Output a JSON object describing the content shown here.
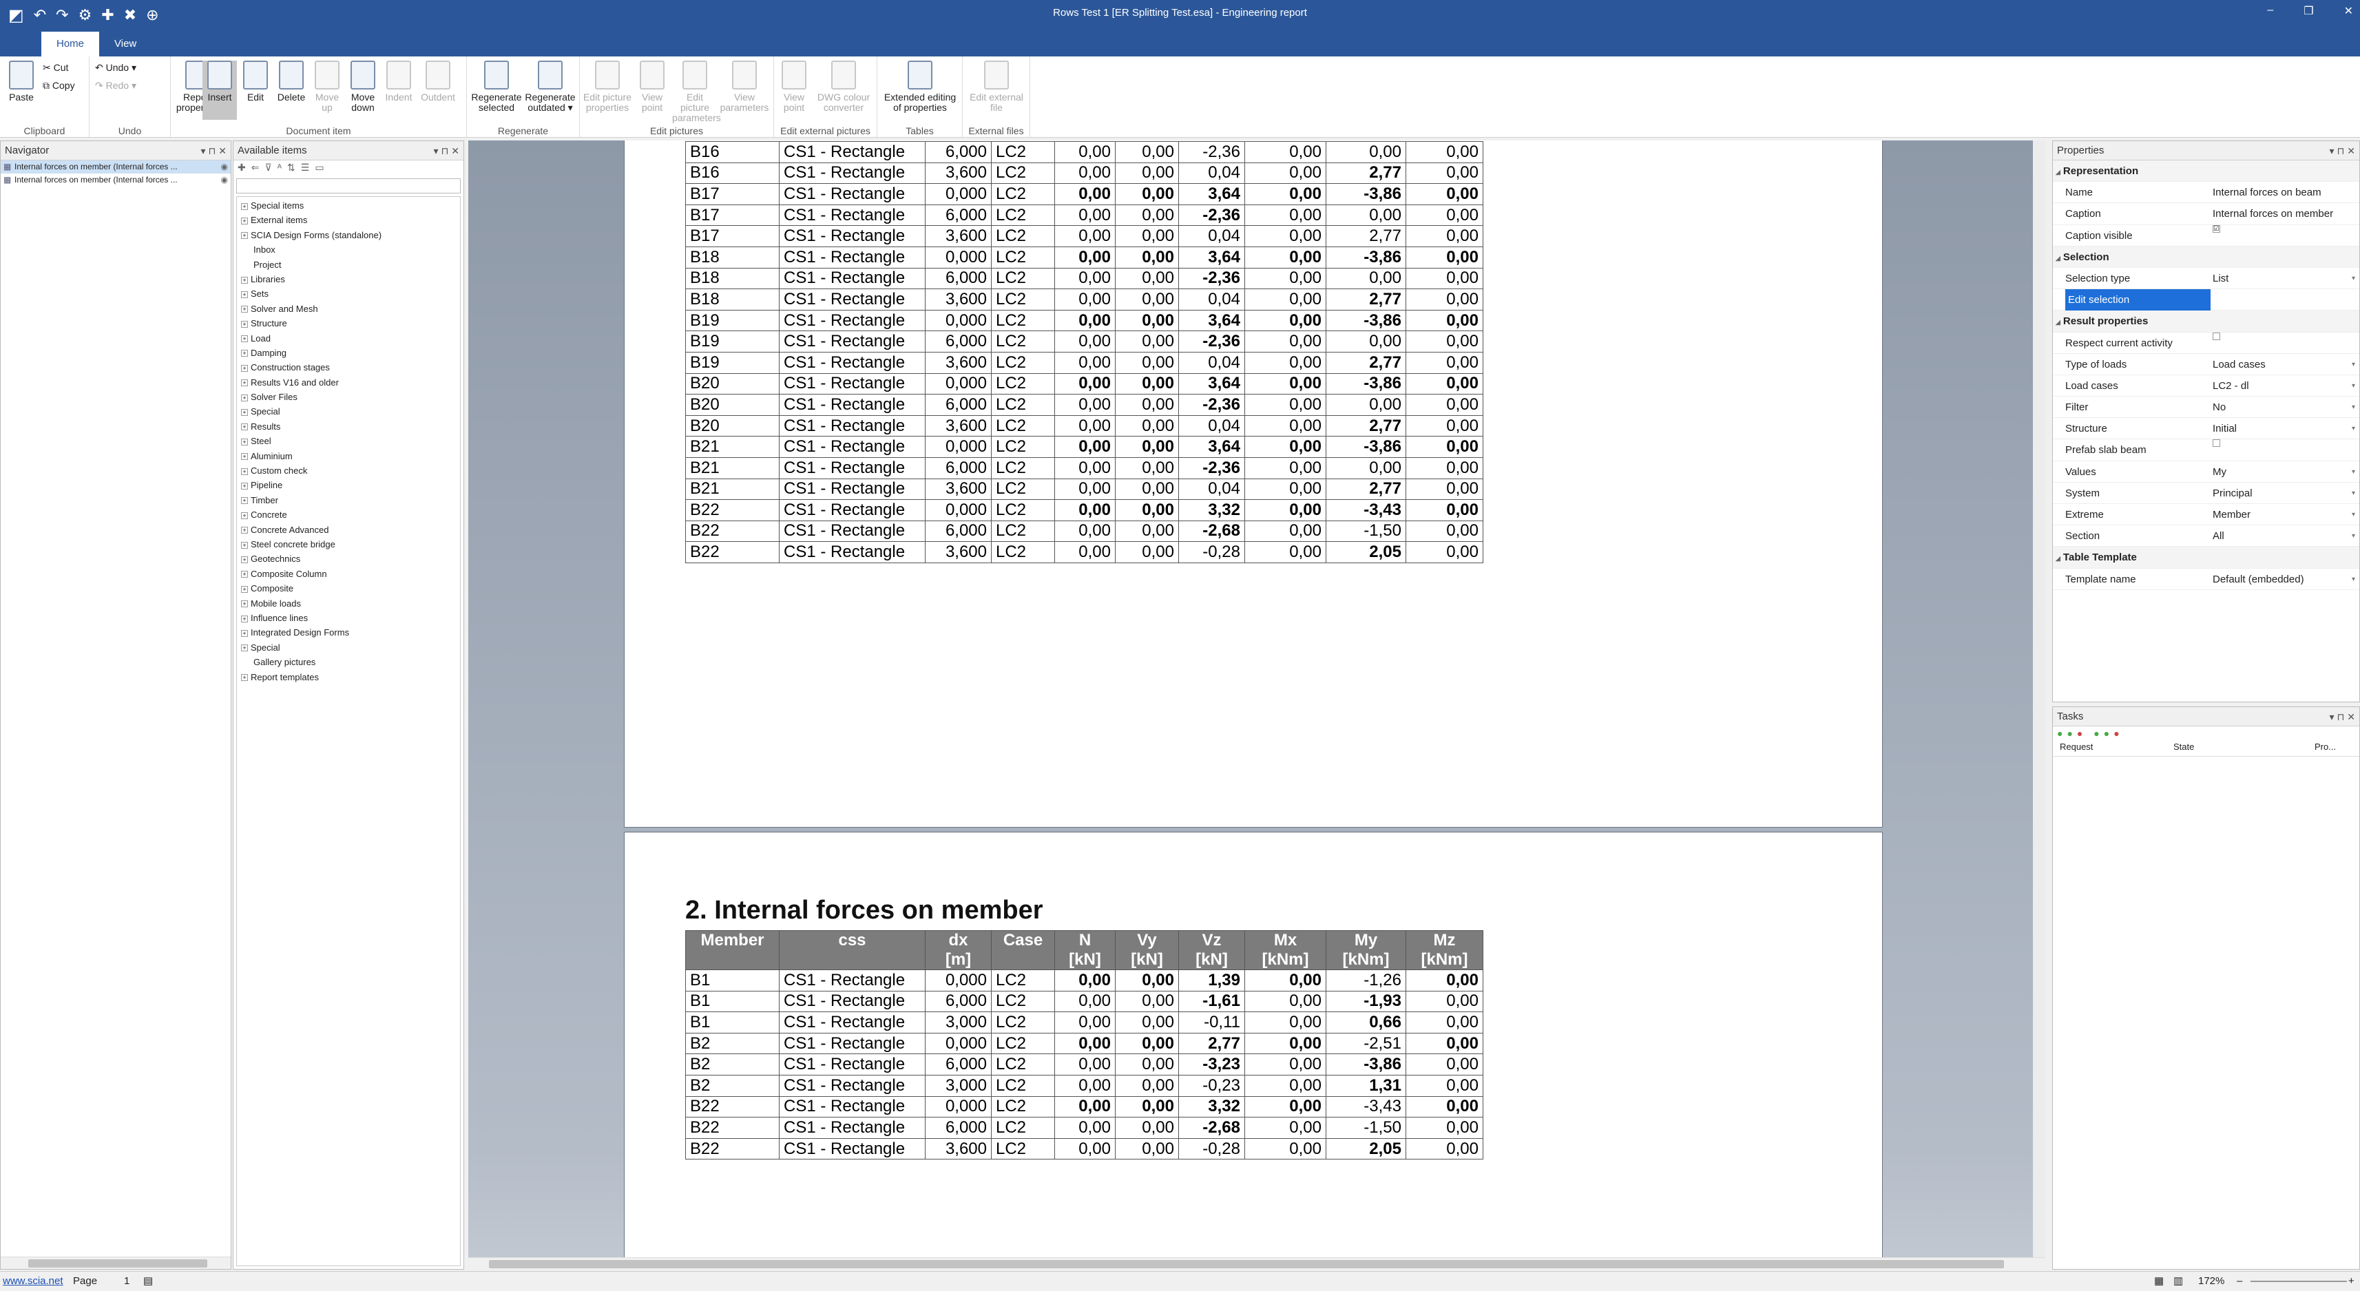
{
  "window": {
    "title": "Rows Test 1 [ER Splitting Test.esa] - Engineering report",
    "minimize": "–",
    "restore": "❐",
    "close": "✕"
  },
  "quick_access": [
    "↶",
    "↷",
    "⚙",
    "✚",
    "✖",
    "⊕"
  ],
  "tabs": [
    "Home",
    "View"
  ],
  "ribbon": {
    "clipboard": {
      "paste": "Paste",
      "cut": "Cut",
      "copy": "Copy",
      "label": "Clipboard"
    },
    "undo": {
      "undo": "Undo",
      "redo": "Redo",
      "label": "Undo"
    },
    "document_item": {
      "report_properties": "Report properties",
      "insert": "Insert",
      "edit": "Edit",
      "delete": "Delete",
      "move_up": "Move up",
      "move_down": "Move down",
      "indent": "Indent",
      "outdent": "Outdent",
      "label": "Document item"
    },
    "regenerate": {
      "selected": "Regenerate selected",
      "outdated": "Regenerate outdated",
      "label": "Regenerate"
    },
    "edit_pictures": {
      "edit_picture_properties": "Edit picture properties",
      "view_point": "View point",
      "edit_picture_parameters": "Edit picture parameters",
      "view_parameters": "View parameters",
      "label": "Edit pictures"
    },
    "edit_external_pictures": {
      "view_point": "View point",
      "dwg_colour_converter": "DWG colour converter",
      "label": "Edit external pictures"
    },
    "tables": {
      "extended_editing": "Extended editing of properties",
      "label": "Tables"
    },
    "external_files": {
      "edit_external_file": "Edit external file",
      "label": "External files"
    }
  },
  "navigator": {
    "title": "Navigator",
    "items": [
      "Internal forces on member (Internal forces ...",
      "Internal forces on member (Internal forces ..."
    ]
  },
  "available_items": {
    "title": "Available items",
    "tree": [
      {
        "label": "Special items",
        "exp": true
      },
      {
        "label": "External items",
        "exp": true
      },
      {
        "label": "SCIA Design Forms (standalone)",
        "exp": true
      },
      {
        "label": "Inbox",
        "exp": false
      },
      {
        "label": "Project",
        "exp": false
      },
      {
        "label": "Libraries",
        "exp": true
      },
      {
        "label": "Sets",
        "exp": true
      },
      {
        "label": "Solver and Mesh",
        "exp": true
      },
      {
        "label": "Structure",
        "exp": true
      },
      {
        "label": "Load",
        "exp": true
      },
      {
        "label": "Damping",
        "exp": true
      },
      {
        "label": "Construction stages",
        "exp": true
      },
      {
        "label": "Results V16 and older",
        "exp": true
      },
      {
        "label": "Solver Files",
        "exp": true
      },
      {
        "label": "Special",
        "exp": true
      },
      {
        "label": "Results",
        "exp": true
      },
      {
        "label": "Steel",
        "exp": true
      },
      {
        "label": "Aluminium",
        "exp": true
      },
      {
        "label": "Custom check",
        "exp": true
      },
      {
        "label": "Pipeline",
        "exp": true
      },
      {
        "label": "Timber",
        "exp": true
      },
      {
        "label": "Concrete",
        "exp": true
      },
      {
        "label": "Concrete Advanced",
        "exp": true
      },
      {
        "label": "Steel concrete bridge",
        "exp": true
      },
      {
        "label": "Geotechnics",
        "exp": true
      },
      {
        "label": "Composite Column",
        "exp": true
      },
      {
        "label": "Composite",
        "exp": true
      },
      {
        "label": "Mobile loads",
        "exp": true
      },
      {
        "label": "Influence lines",
        "exp": true
      },
      {
        "label": "Integrated Design Forms",
        "exp": true
      },
      {
        "label": "Special",
        "exp": true
      },
      {
        "label": "Gallery pictures",
        "exp": false
      },
      {
        "label": "Report templates",
        "exp": true
      }
    ]
  },
  "report": {
    "page1_rows": [
      [
        "B16",
        "CS1 - Rectangle",
        "6,000",
        "LC2",
        "0,00",
        "0,00",
        "-2,36",
        "0,00",
        "0,00",
        "0,00"
      ],
      [
        "B16",
        "CS1 - Rectangle",
        "3,600",
        "LC2",
        "0,00",
        "0,00",
        "0,04",
        "0,00",
        "2,77",
        "0,00"
      ],
      [
        "B17",
        "CS1 - Rectangle",
        "0,000",
        "LC2",
        "0,00",
        "0,00",
        "3,64",
        "0,00",
        "-3,86",
        "0,00"
      ],
      [
        "B17",
        "CS1 - Rectangle",
        "6,000",
        "LC2",
        "0,00",
        "0,00",
        "-2,36",
        "0,00",
        "0,00",
        "0,00"
      ],
      [
        "B17",
        "CS1 - Rectangle",
        "3,600",
        "LC2",
        "0,00",
        "0,00",
        "0,04",
        "0,00",
        "2,77",
        "0,00"
      ],
      [
        "B18",
        "CS1 - Rectangle",
        "0,000",
        "LC2",
        "0,00",
        "0,00",
        "3,64",
        "0,00",
        "-3,86",
        "0,00"
      ],
      [
        "B18",
        "CS1 - Rectangle",
        "6,000",
        "LC2",
        "0,00",
        "0,00",
        "-2,36",
        "0,00",
        "0,00",
        "0,00"
      ],
      [
        "B18",
        "CS1 - Rectangle",
        "3,600",
        "LC2",
        "0,00",
        "0,00",
        "0,04",
        "0,00",
        "2,77",
        "0,00"
      ],
      [
        "B19",
        "CS1 - Rectangle",
        "0,000",
        "LC2",
        "0,00",
        "0,00",
        "3,64",
        "0,00",
        "-3,86",
        "0,00"
      ],
      [
        "B19",
        "CS1 - Rectangle",
        "6,000",
        "LC2",
        "0,00",
        "0,00",
        "-2,36",
        "0,00",
        "0,00",
        "0,00"
      ],
      [
        "B19",
        "CS1 - Rectangle",
        "3,600",
        "LC2",
        "0,00",
        "0,00",
        "0,04",
        "0,00",
        "2,77",
        "0,00"
      ],
      [
        "B20",
        "CS1 - Rectangle",
        "0,000",
        "LC2",
        "0,00",
        "0,00",
        "3,64",
        "0,00",
        "-3,86",
        "0,00"
      ],
      [
        "B20",
        "CS1 - Rectangle",
        "6,000",
        "LC2",
        "0,00",
        "0,00",
        "-2,36",
        "0,00",
        "0,00",
        "0,00"
      ],
      [
        "B20",
        "CS1 - Rectangle",
        "3,600",
        "LC2",
        "0,00",
        "0,00",
        "0,04",
        "0,00",
        "2,77",
        "0,00"
      ],
      [
        "B21",
        "CS1 - Rectangle",
        "0,000",
        "LC2",
        "0,00",
        "0,00",
        "3,64",
        "0,00",
        "-3,86",
        "0,00"
      ],
      [
        "B21",
        "CS1 - Rectangle",
        "6,000",
        "LC2",
        "0,00",
        "0,00",
        "-2,36",
        "0,00",
        "0,00",
        "0,00"
      ],
      [
        "B21",
        "CS1 - Rectangle",
        "3,600",
        "LC2",
        "0,00",
        "0,00",
        "0,04",
        "0,00",
        "2,77",
        "0,00"
      ],
      [
        "B22",
        "CS1 - Rectangle",
        "0,000",
        "LC2",
        "0,00",
        "0,00",
        "3,32",
        "0,00",
        "-3,43",
        "0,00"
      ],
      [
        "B22",
        "CS1 - Rectangle",
        "6,000",
        "LC2",
        "0,00",
        "0,00",
        "-2,68",
        "0,00",
        "-1,50",
        "0,00"
      ],
      [
        "B22",
        "CS1 - Rectangle",
        "3,600",
        "LC2",
        "0,00",
        "0,00",
        "-0,28",
        "0,00",
        "2,05",
        "0,00"
      ]
    ],
    "page1_bold": [
      [],
      [
        8
      ],
      [
        4,
        5,
        6,
        7,
        8,
        9
      ],
      [
        6
      ],
      [],
      [
        4,
        5,
        6,
        7,
        8,
        9
      ],
      [
        6
      ],
      [
        8
      ],
      [
        4,
        5,
        6,
        7,
        8,
        9
      ],
      [
        6
      ],
      [
        8
      ],
      [
        4,
        5,
        6,
        7,
        8,
        9
      ],
      [
        6
      ],
      [
        8
      ],
      [
        4,
        5,
        6,
        7,
        8,
        9
      ],
      [
        6
      ],
      [
        8
      ],
      [
        4,
        5,
        6,
        7,
        8,
        9
      ],
      [
        6
      ],
      [
        8
      ]
    ],
    "section_title": "2. Internal forces on member",
    "headers": [
      [
        "Member",
        ""
      ],
      [
        "css",
        ""
      ],
      [
        "dx",
        "[m]"
      ],
      [
        "Case",
        ""
      ],
      [
        "N",
        "[kN]"
      ],
      [
        "Vy",
        "[kN]"
      ],
      [
        "Vz",
        "[kN]"
      ],
      [
        "Mx",
        "[kNm]"
      ],
      [
        "My",
        "[kNm]"
      ],
      [
        "Mz",
        "[kNm]"
      ]
    ],
    "page2_rows": [
      [
        "B1",
        "CS1 - Rectangle",
        "0,000",
        "LC2",
        "0,00",
        "0,00",
        "1,39",
        "0,00",
        "-1,26",
        "0,00"
      ],
      [
        "B1",
        "CS1 - Rectangle",
        "6,000",
        "LC2",
        "0,00",
        "0,00",
        "-1,61",
        "0,00",
        "-1,93",
        "0,00"
      ],
      [
        "B1",
        "CS1 - Rectangle",
        "3,000",
        "LC2",
        "0,00",
        "0,00",
        "-0,11",
        "0,00",
        "0,66",
        "0,00"
      ],
      [
        "B2",
        "CS1 - Rectangle",
        "0,000",
        "LC2",
        "0,00",
        "0,00",
        "2,77",
        "0,00",
        "-2,51",
        "0,00"
      ],
      [
        "B2",
        "CS1 - Rectangle",
        "6,000",
        "LC2",
        "0,00",
        "0,00",
        "-3,23",
        "0,00",
        "-3,86",
        "0,00"
      ],
      [
        "B2",
        "CS1 - Rectangle",
        "3,000",
        "LC2",
        "0,00",
        "0,00",
        "-0,23",
        "0,00",
        "1,31",
        "0,00"
      ],
      [
        "B22",
        "CS1 - Rectangle",
        "0,000",
        "LC2",
        "0,00",
        "0,00",
        "3,32",
        "0,00",
        "-3,43",
        "0,00"
      ],
      [
        "B22",
        "CS1 - Rectangle",
        "6,000",
        "LC2",
        "0,00",
        "0,00",
        "-2,68",
        "0,00",
        "-1,50",
        "0,00"
      ],
      [
        "B22",
        "CS1 - Rectangle",
        "3,600",
        "LC2",
        "0,00",
        "0,00",
        "-0,28",
        "0,00",
        "2,05",
        "0,00"
      ]
    ],
    "page2_bold": [
      [
        4,
        5,
        6,
        7,
        9
      ],
      [
        6,
        8
      ],
      [
        8
      ],
      [
        4,
        5,
        6,
        7,
        9
      ],
      [
        6,
        8
      ],
      [
        8
      ],
      [
        4,
        5,
        6,
        7,
        9
      ],
      [
        6
      ],
      [
        8
      ]
    ]
  },
  "properties": {
    "title": "Properties",
    "rows": [
      {
        "k": "Representation",
        "cat": true
      },
      {
        "k": "Name",
        "v": "Internal forces on beam"
      },
      {
        "k": "Caption",
        "v": "Internal forces on member"
      },
      {
        "k": "Caption visible",
        "v": "☑",
        "chk": true
      },
      {
        "k": "Selection",
        "cat": true
      },
      {
        "k": "Selection type",
        "v": "List",
        "dd": true
      },
      {
        "k": "Edit selection",
        "v": "",
        "sel": true
      },
      {
        "k": "Result properties",
        "cat": true
      },
      {
        "k": "Respect current activity",
        "v": "",
        "chk": true
      },
      {
        "k": "Type of loads",
        "v": "Load cases",
        "dd": true
      },
      {
        "k": "Load cases",
        "v": "LC2 - dl",
        "dd": true
      },
      {
        "k": "Filter",
        "v": "No",
        "dd": true
      },
      {
        "k": "Structure",
        "v": "Initial",
        "dd": true
      },
      {
        "k": "Prefab slab beam",
        "v": "",
        "chk": true
      },
      {
        "k": "Values",
        "v": "My",
        "dd": true
      },
      {
        "k": "System",
        "v": "Principal",
        "dd": true
      },
      {
        "k": "Extreme",
        "v": "Member",
        "dd": true
      },
      {
        "k": "Section",
        "v": "All",
        "dd": true
      },
      {
        "k": "Table Template",
        "cat": true
      },
      {
        "k": "Template name",
        "v": "Default (embedded)",
        "dd": true
      }
    ]
  },
  "tasks": {
    "title": "Tasks",
    "columns": [
      "Request",
      "State",
      "Pro..."
    ]
  },
  "status": {
    "link": "www.scia.net",
    "page_label": "Page",
    "page_num": "1",
    "zoom": "172%",
    "minus": "–",
    "plus": "+"
  },
  "colors": {
    "titlebar": "#2b579a",
    "table_header": "#7c7c7c",
    "selection": "#1e6fd9"
  }
}
